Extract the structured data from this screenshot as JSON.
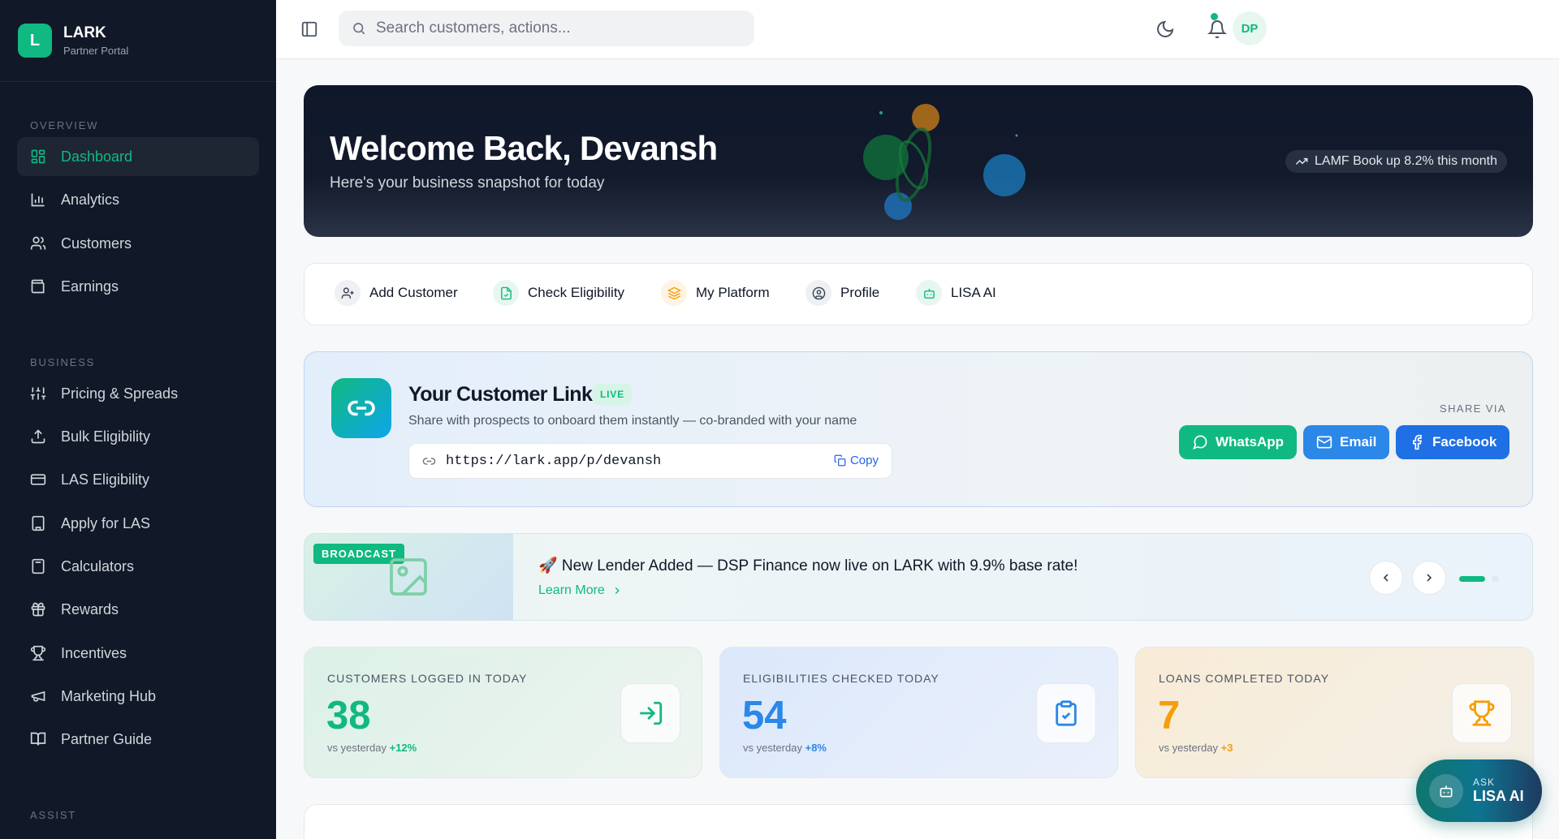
{
  "brand": {
    "logo_letter": "L",
    "name": "LARK",
    "subtitle": "Partner Portal"
  },
  "sidebar": {
    "sections": [
      "OVERVIEW",
      "BUSINESS",
      "ASSIST"
    ],
    "items": [
      {
        "label": "Dashboard",
        "icon": "grid-icon",
        "active": true
      },
      {
        "label": "Analytics",
        "icon": "bar-chart-icon"
      },
      {
        "label": "Customers",
        "icon": "users-icon"
      },
      {
        "label": "Earnings",
        "icon": "wallet-icon"
      },
      {
        "label": "Pricing & Spreads",
        "icon": "sliders-icon"
      },
      {
        "label": "Bulk Eligibility",
        "icon": "upload-icon"
      },
      {
        "label": "LAS Eligibility",
        "icon": "credit-card-icon"
      },
      {
        "label": "Apply for LAS",
        "icon": "building-icon"
      },
      {
        "label": "Calculators",
        "icon": "calculator-icon"
      },
      {
        "label": "Rewards",
        "icon": "gift-icon"
      },
      {
        "label": "Incentives",
        "icon": "trophy-icon"
      },
      {
        "label": "Marketing Hub",
        "icon": "megaphone-icon"
      },
      {
        "label": "Partner Guide",
        "icon": "book-icon"
      }
    ]
  },
  "topbar": {
    "search_placeholder": "Search customers, actions...",
    "avatar_initials": "DP",
    "has_notification": true
  },
  "hero": {
    "title": "Welcome Back, Devansh",
    "subtitle": "Here's your business snapshot for today",
    "badge": "LAMF Book up 8.2% this month"
  },
  "quick_actions": [
    {
      "label": "Add Customer",
      "icon": "user-plus-icon"
    },
    {
      "label": "Check Eligibility",
      "icon": "file-check-icon"
    },
    {
      "label": "My Platform",
      "icon": "layers-icon"
    },
    {
      "label": "Profile",
      "icon": "user-circle-icon"
    },
    {
      "label": "LISA AI",
      "icon": "bot-icon"
    }
  ],
  "customer_link": {
    "title": "Your Customer Link",
    "badge": "LIVE",
    "description": "Share with prospects to onboard them instantly — co-branded with your name",
    "url": "https://lark.app/p/devansh",
    "copy_label": "Copy",
    "share_label": "SHARE VIA",
    "share_buttons": [
      {
        "label": "WhatsApp",
        "color": "#10b981"
      },
      {
        "label": "Email",
        "color": "#2b87e8"
      },
      {
        "label": "Facebook",
        "color": "#1f6fe5"
      }
    ]
  },
  "broadcast": {
    "tag": "BROADCAST",
    "message": "🚀 New Lender Added — DSP Finance now live on LARK with 9.9% base rate!",
    "link_label": "Learn More",
    "slide_count": 2,
    "active_slide": 1
  },
  "stats": [
    {
      "label": "CUSTOMERS LOGGED IN TODAY",
      "value": "38",
      "cmp_prefix": "vs yesterday",
      "change": "+12%",
      "color": "#10b981",
      "icon": "login-icon"
    },
    {
      "label": "ELIGIBILITIES CHECKED TODAY",
      "value": "54",
      "cmp_prefix": "vs yesterday",
      "change": "+8%",
      "color": "#2b87e8",
      "icon": "clipboard-check-icon"
    },
    {
      "label": "LOANS COMPLETED TODAY",
      "value": "7",
      "cmp_prefix": "vs yesterday",
      "change": "+3",
      "color": "#f59e0b",
      "icon": "trophy-icon"
    }
  ],
  "lisa_fab": {
    "small": "ASK",
    "big": "LISA AI"
  }
}
